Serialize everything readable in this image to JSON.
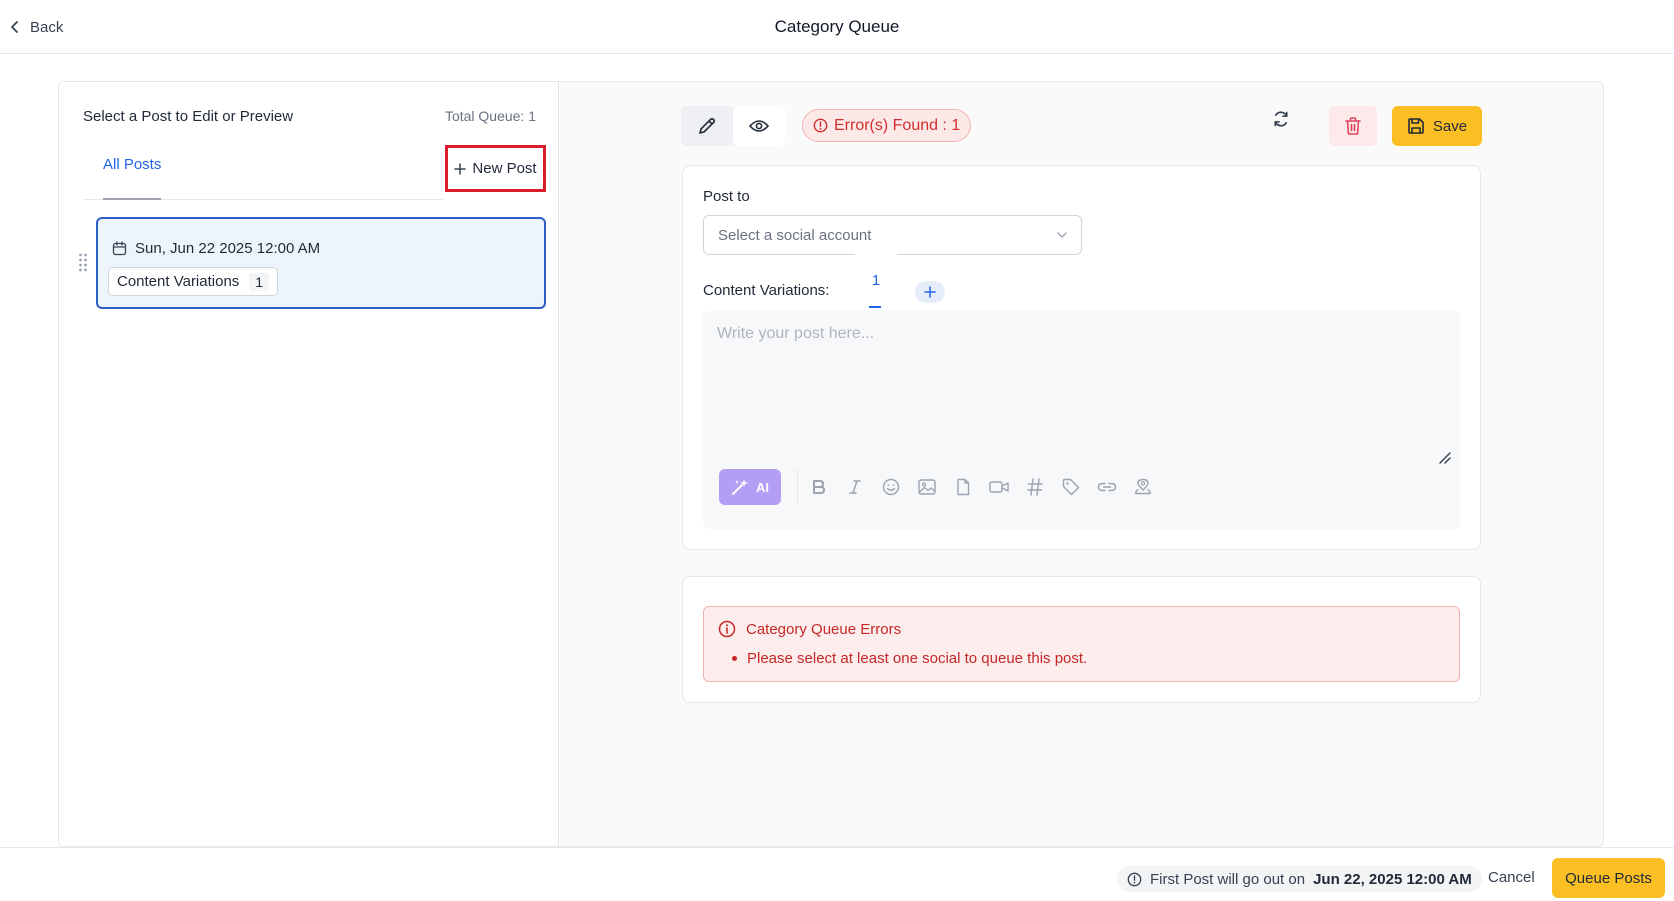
{
  "header": {
    "back_label": "Back",
    "title": "Category Queue"
  },
  "left_panel": {
    "heading": "Select a Post to Edit or Preview",
    "total_queue": "Total Queue: 1",
    "tabs": [
      {
        "label": "All Posts",
        "active": true
      }
    ],
    "new_post_label": "New Post",
    "posts": [
      {
        "date": "Sun, Jun 22 2025 12:00 AM",
        "variations_label": "Content Variations",
        "variations_count": "1"
      }
    ]
  },
  "toolbar": {
    "edit_icon": "pencil-icon",
    "preview_icon": "eye-icon",
    "error_badge": "Error(s) Found : 1",
    "save_label": "Save"
  },
  "editor": {
    "post_to_label": "Post to",
    "account_placeholder": "Select a social account",
    "content_variations_label": "Content Variations:",
    "variation_tabs": [
      "1"
    ],
    "post_placeholder": "Write your post here...",
    "ai_label": "AI",
    "format_tools": [
      "bold",
      "italic",
      "emoji",
      "image",
      "file",
      "video",
      "hashtag",
      "tag",
      "link",
      "location"
    ]
  },
  "errors": {
    "title": "Category Queue Errors",
    "items": [
      "Please select at least one social to queue this post."
    ]
  },
  "footer": {
    "note_prefix": "First Post will go out on",
    "note_date": "Jun 22, 2025 12:00 AM",
    "cancel_label": "Cancel",
    "queue_label": "Queue Posts"
  },
  "colors": {
    "accent_yellow": "#fbbf24",
    "link_blue": "#2563eb",
    "error_red": "#d32f2f",
    "highlight_border": "#d91e2b"
  }
}
